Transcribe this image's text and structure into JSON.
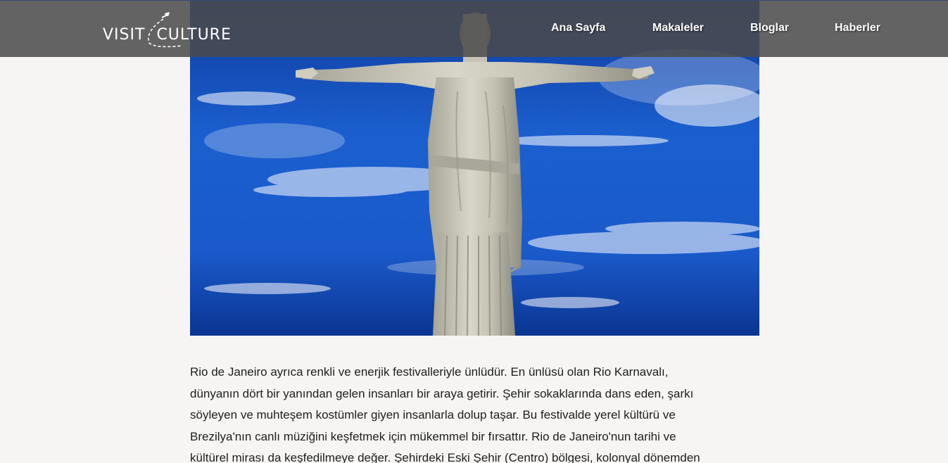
{
  "header": {
    "logo": {
      "part1": "VISIT",
      "part2": "CULTURE",
      "icon": "airplane-swoosh-icon"
    },
    "nav": [
      {
        "label": "Ana Sayfa"
      },
      {
        "label": "Makaleler"
      },
      {
        "label": "Bloglar"
      },
      {
        "label": "Haberler"
      }
    ]
  },
  "hero": {
    "image": "christ-the-redeemer-statue",
    "sky_color": "#1c63d6"
  },
  "article": {
    "lines": [
      "Rio de Janeiro ayrıca renkli ve enerjik festivalleriyle ünlüdür. En ünlüsü olan Rio Karnavalı,",
      "dünyanın dört bir yanından gelen insanları bir araya getirir. Şehir sokaklarında dans eden, şarkı",
      "söyleyen ve muhteşem kostümler giyen insanlarla dolup taşar. Bu festivalde yerel kültürü ve",
      "Brezilya'nın canlı müziğini keşfetmek için mükemmel bir fırsattır. Rio de Janeiro'nun tarihi ve",
      "kültürel mirası da keşfedilmeye değer. Şehirdeki Eski Şehir (Centro) bölgesi, kolonyal dönemden"
    ]
  }
}
